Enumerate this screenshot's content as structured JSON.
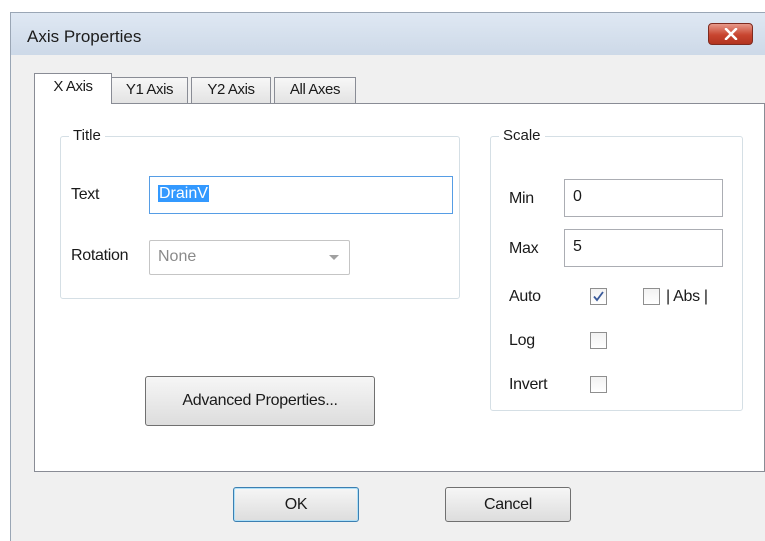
{
  "window": {
    "title": "Axis Properties",
    "close_icon": "close-x-icon"
  },
  "tabs": [
    {
      "label": "X Axis",
      "active": true
    },
    {
      "label": "Y1 Axis",
      "active": false
    },
    {
      "label": "Y2 Axis",
      "active": false
    },
    {
      "label": "All Axes",
      "active": false
    }
  ],
  "title_group": {
    "legend": "Title",
    "text_label": "Text",
    "text_value": "DrainV",
    "rotation_label": "Rotation",
    "rotation_value": "None"
  },
  "scale_group": {
    "legend": "Scale",
    "min_label": "Min",
    "min_value": "0",
    "max_label": "Max",
    "max_value": "5",
    "auto_label": "Auto",
    "auto_checked": true,
    "abs_label": "| Abs |",
    "abs_checked": false,
    "log_label": "Log",
    "log_checked": false,
    "invert_label": "Invert",
    "invert_checked": false
  },
  "buttons": {
    "advanced": "Advanced Properties...",
    "ok": "OK",
    "cancel": "Cancel"
  },
  "colors": {
    "selection": "#3399ff",
    "close_button": "#c84530",
    "focus_border": "#569de5"
  }
}
